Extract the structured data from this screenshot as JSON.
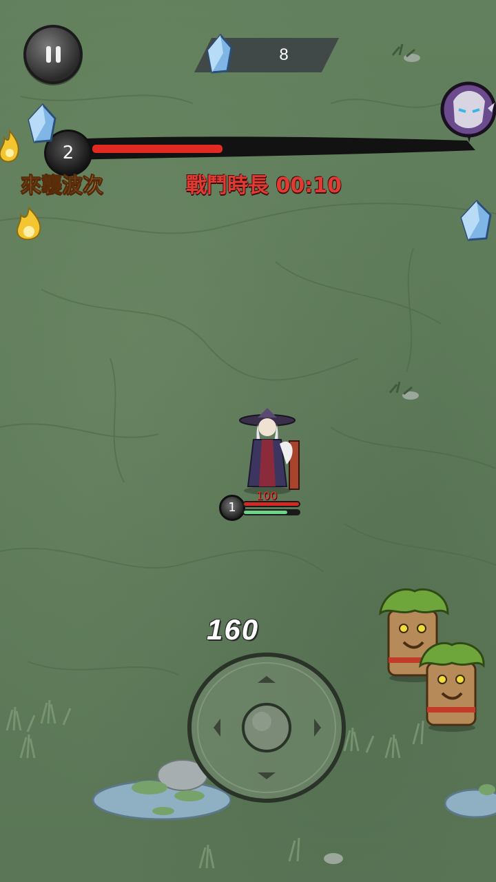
{
  "hud": {
    "pause_icon": "pause-icon",
    "crystal_icon": "blue-crystal-icon",
    "crystal_count": "8",
    "wave_number": "2",
    "wave_label": "來襲波次",
    "wave_progress": 0.35,
    "battle_time_label": "戰鬥時長 00:10",
    "boss_icon": "boss-portrait-icon"
  },
  "player": {
    "hp_value": "100",
    "level": "1",
    "hp_fraction": 1.0,
    "xp_fraction": 0.8
  },
  "combat": {
    "damage_number": "160"
  },
  "controls": {
    "joystick_icon": "virtual-joystick"
  },
  "colors": {
    "ground": "#5f7a5a",
    "hp_red": "#d22a22",
    "xp_green": "#6ed48a",
    "wave_text": "#f0b35a",
    "time_text": "#e03b33"
  }
}
